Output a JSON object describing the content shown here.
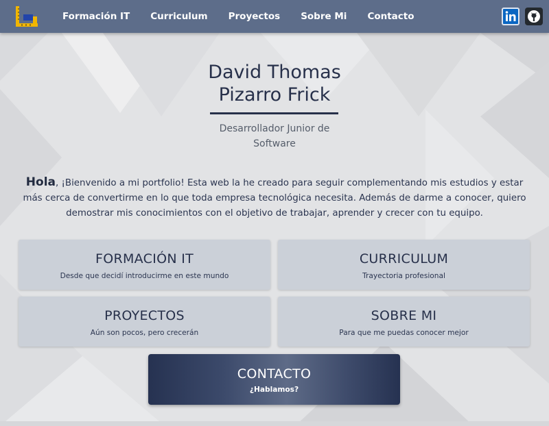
{
  "nav": {
    "links": [
      "Formación IT",
      "Curriculum",
      "Proyectos",
      "Sobre Mi",
      "Contacto"
    ],
    "icons": [
      "linkedin-icon",
      "github-icon"
    ],
    "bar_color": "#5d6d8a"
  },
  "hero": {
    "name_line1": "David Thomas",
    "name_line2": "Pizarro Frick",
    "role_line1": "Desarrollador Junior de",
    "role_line2": "Software"
  },
  "intro": {
    "greeting": "Hola",
    "line1": ", ¡Bienvenido a mi portfolio! Esta web la he creado para seguir complementando mis estudios y estar",
    "line2": "más cerca de convertirme en lo que toda empresa tecnológica necesita. Además de darme a conocer, quiero",
    "line3": "demostrar mis conocimientos con el objetivo de trabajar, aprender y crecer con tu equipo."
  },
  "cards": [
    {
      "title": "FORMACIÓN IT",
      "subtitle": "Desde que decidí introducirme en este mundo"
    },
    {
      "title": "CURRICULUM",
      "subtitle": "Trayectoria profesional"
    },
    {
      "title": "PROYECTOS",
      "subtitle": "Aún son pocos, pero crecerán"
    },
    {
      "title": "SOBRE MI",
      "subtitle": "Para que me puedas conocer mejor"
    }
  ],
  "contact": {
    "title": "CONTACTO",
    "subtitle": "¿Hablamos?",
    "colors": [
      "#263251",
      "#5e6b87"
    ]
  }
}
